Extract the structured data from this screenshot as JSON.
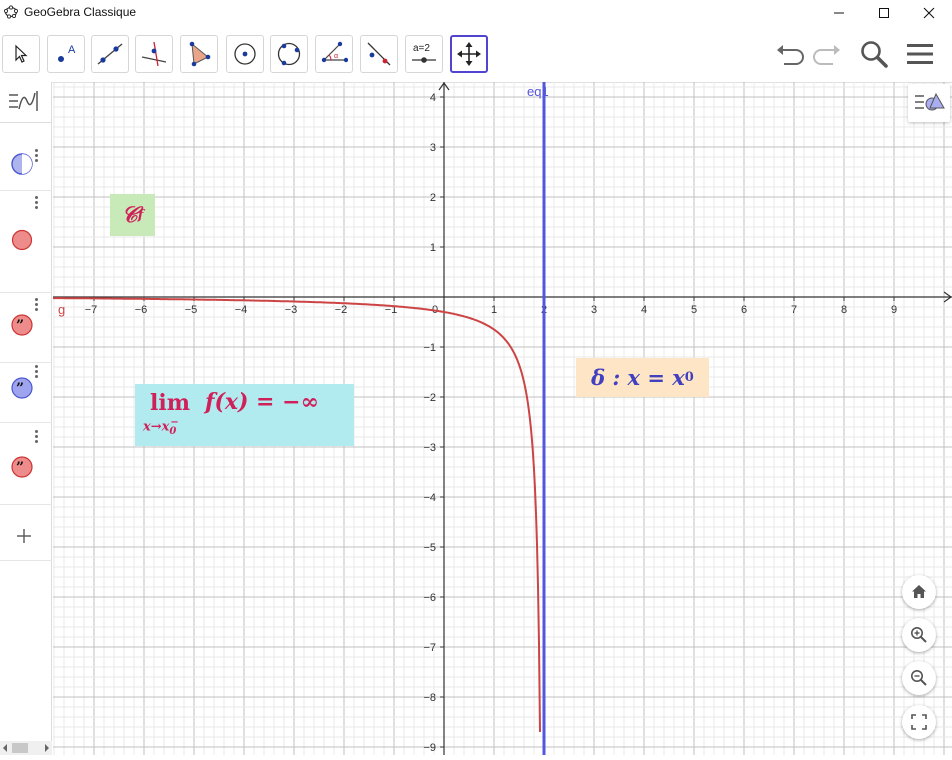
{
  "window": {
    "title": "GeoGebra Classique"
  },
  "toolbar": {
    "tools": [
      {
        "name": "move-tool"
      },
      {
        "name": "point-tool"
      },
      {
        "name": "line-tool"
      },
      {
        "name": "perpendicular-line-tool"
      },
      {
        "name": "polygon-tool"
      },
      {
        "name": "circle-center-point-tool"
      },
      {
        "name": "circle-through-3-points-tool"
      },
      {
        "name": "angle-tool"
      },
      {
        "name": "reflect-about-line-tool"
      },
      {
        "name": "slider-tool"
      },
      {
        "name": "move-graphics-view-tool"
      }
    ],
    "slider_label": "a=2",
    "active_tool": "move-graphics-view-tool"
  },
  "graphics": {
    "x_ticks": [
      "−7",
      "−6",
      "−5",
      "−4",
      "−3",
      "−2",
      "−1",
      "0",
      "1",
      "2",
      "3",
      "4",
      "5",
      "6",
      "7",
      "8",
      "9"
    ],
    "y_ticks": [
      "4",
      "3",
      "2",
      "1",
      "−1",
      "−2",
      "−3",
      "−4",
      "−5",
      "−6",
      "−7",
      "−8",
      "−9"
    ],
    "line_label": "eq1",
    "curve_label": "g",
    "curve_color": "#cc4444",
    "line_color": "#5555dd"
  },
  "texts": {
    "cf_main": "𝒞",
    "cf_sub": "f",
    "lim_word": "lim",
    "lim_sub": "x→x",
    "lim_sub_index": "0",
    "lim_sub_sup": "−",
    "lim_expr": "f(x) = −∞",
    "delta_main": "δ : x = x",
    "delta_sub": "0"
  },
  "colors": {
    "accent": "#5145d0",
    "text_red": "#d0205a",
    "text_blue": "#4040c0"
  }
}
